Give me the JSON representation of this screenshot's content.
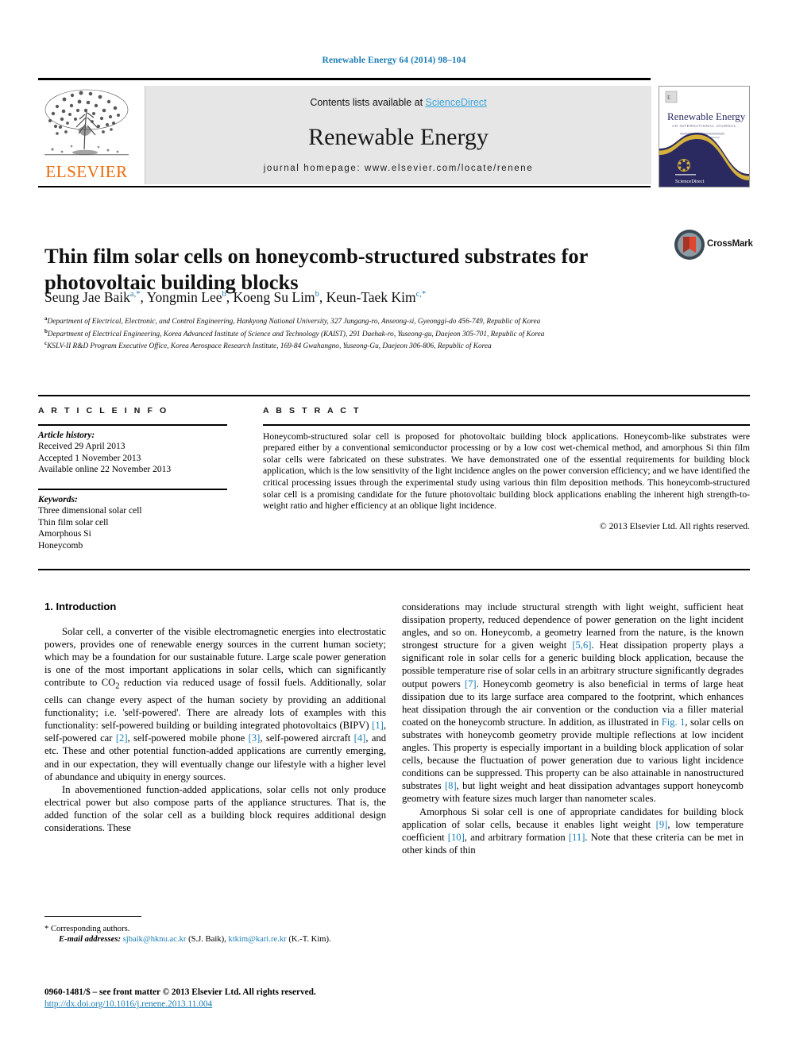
{
  "running_head": "Renewable Energy 64 (2014) 98–104",
  "masthead": {
    "contents_prefix": "Contents lists available at ",
    "sciencedirect": "ScienceDirect",
    "journal_name": "Renewable Energy",
    "homepage": "journal homepage: www.elsevier.com/locate/renene",
    "publisher": "ELSEVIER",
    "cover_title": "Renewable Energy",
    "cover_subtitle": "AN INTERNATIONAL JOURNAL"
  },
  "article": {
    "title": "Thin film solar cells on honeycomb-structured substrates for photovoltaic building blocks",
    "crossmark_label": "CrossMark",
    "authors": [
      {
        "name": "Seung Jae Baik",
        "marks": "a,*"
      },
      {
        "name": "Yongmin Lee",
        "marks": "b"
      },
      {
        "name": "Koeng Su Lim",
        "marks": "b"
      },
      {
        "name": "Keun-Taek Kim",
        "marks": "c,*"
      }
    ],
    "affiliations": [
      {
        "mark": "a",
        "text": "Department of Electrical, Electronic, and Control Engineering, Hankyong National University, 327 Jungang-ro, Anseong-si, Gyeonggi-do 456-749, Republic of Korea"
      },
      {
        "mark": "b",
        "text": "Department of Electrical Engineering, Korea Advanced Institute of Science and Technology (KAIST), 291 Daehak-ro, Yuseong-gu, Daejeon 305-701, Republic of Korea"
      },
      {
        "mark": "c",
        "text": "KSLV-II R&D Program Executive Office, Korea Aerospace Research Institute, 169-84 Gwahangno, Yuseong-Gu, Daejeon 306-806, Republic of Korea"
      }
    ]
  },
  "article_info": {
    "heading": "A R T I C L E  I N F O",
    "history_label": "Article history:",
    "history": [
      "Received 29 April 2013",
      "Accepted 1 November 2013",
      "Available online 22 November 2013"
    ],
    "keywords_label": "Keywords:",
    "keywords": [
      "Three dimensional solar cell",
      "Thin film solar cell",
      "Amorphous Si",
      "Honeycomb"
    ]
  },
  "abstract": {
    "heading": "A B S T R A C T",
    "text": "Honeycomb-structured solar cell is proposed for photovoltaic building block applications. Honeycomb-like substrates were prepared either by a conventional semiconductor processing or by a low cost wet-chemical method, and amorphous Si thin film solar cells were fabricated on these substrates. We have demonstrated one of the essential requirements for building block application, which is the low sensitivity of the light incidence angles on the power conversion efficiency; and we have identified the critical processing issues through the experimental study using various thin film deposition methods. This honeycomb-structured solar cell is a promising candidate for the future photovoltaic building block applications enabling the inherent high strength-to-weight ratio and higher efficiency at an oblique light incidence.",
    "copyright": "© 2013 Elsevier Ltd. All rights reserved."
  },
  "body": {
    "section_number_title": "1. Introduction",
    "left_paragraphs": [
      "Solar cell, a converter of the visible electromagnetic energies into electrostatic powers, provides one of renewable energy sources in the current human society; which may be a foundation for our sustainable future. Large scale power generation is one of the most important applications in solar cells, which can significantly contribute to CO2 reduction via reduced usage of fossil fuels. Additionally, solar cells can change every aspect of the human society by providing an additional functionality; i.e. 'self-powered'. There are already lots of examples with this functionality: self-powered building or building integrated photovoltaics (BIPV) [1], self-powered car [2], self-powered mobile phone [3], self-powered aircraft [4], and etc. These and other potential function-added applications are currently emerging, and in our expectation, they will eventually change our lifestyle with a higher level of abundance and ubiquity in energy sources.",
      "In abovementioned function-added applications, solar cells not only produce electrical power but also compose parts of the appliance structures. That is, the added function of the solar cell as a building block requires additional design considerations. These"
    ],
    "right_paragraphs": [
      "considerations may include structural strength with light weight, sufficient heat dissipation property, reduced dependence of power generation on the light incident angles, and so on. Honeycomb, a geometry learned from the nature, is the known strongest structure for a given weight [5,6]. Heat dissipation property plays a significant role in solar cells for a generic building block application, because the possible temperature rise of solar cells in an arbitrary structure significantly degrades output powers [7]. Honeycomb geometry is also beneficial in terms of large heat dissipation due to its large surface area compared to the footprint, which enhances heat dissipation through the air convention or the conduction via a filler material coated on the honeycomb structure. In addition, as illustrated in Fig. 1, solar cells on substrates with honeycomb geometry provide multiple reflections at low incident angles. This property is especially important in a building block application of solar cells, because the fluctuation of power generation due to various light incidence conditions can be suppressed. This property can be also attainable in nanostructured substrates [8], but light weight and heat dissipation advantages support honeycomb geometry with feature sizes much larger than nanometer scales.",
      "Amorphous Si solar cell is one of appropriate candidates for building block application of solar cells, because it enables light weight [9], low temperature coefficient [10], and arbitrary formation [11]. Note that these criteria can be met in other kinds of thin"
    ]
  },
  "footnote": {
    "corresponding": "* Corresponding authors.",
    "email_label": "E-mail addresses:",
    "email1": "sjbaik@hknu.ac.kr",
    "email1_owner": "(S.J. Baik),",
    "email2": "ktkim@kari.re.kr",
    "email2_owner": "(K.-T. Kim)."
  },
  "imprint": {
    "line1": "0960-1481/$ – see front matter © 2013 Elsevier Ltd. All rights reserved.",
    "doi": "http://dx.doi.org/10.1016/j.renene.2013.11.004"
  },
  "colors": {
    "link": "#1a7cb4",
    "sciencedirect": "#3ba6dd",
    "elsevier_orange": "#eb6a0a",
    "masthead_bg": "#e6e6e6",
    "cover_navy": "#2b2a60",
    "cover_gold": "#d6b13c"
  }
}
